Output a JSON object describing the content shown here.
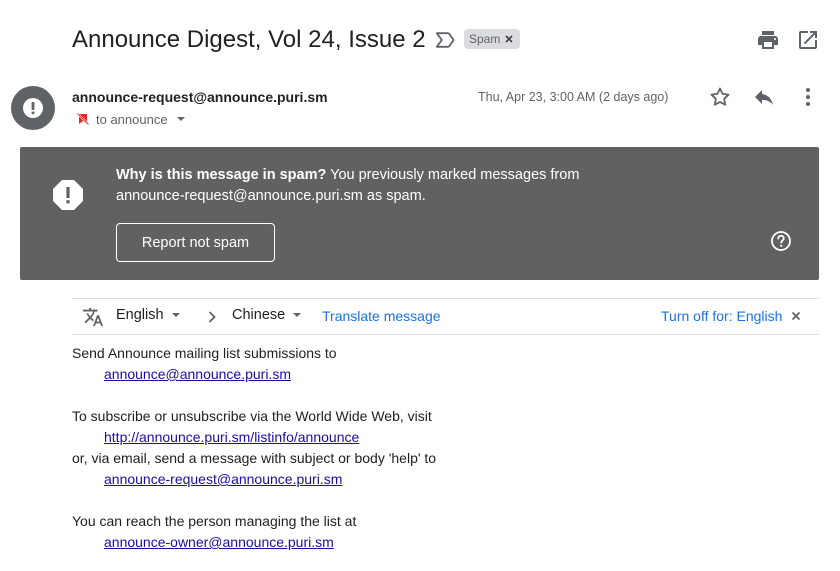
{
  "header": {
    "subject": "Announce Digest, Vol 24, Issue 2",
    "spam_label": "Spam",
    "icons": {
      "label": "label-outline-icon",
      "print": "print-icon",
      "popout": "open-in-new-window-icon"
    }
  },
  "message": {
    "sender_email": "announce-request@announce.puri.sm",
    "to_text": "to announce",
    "date": "Thu, Apr 23, 3:00 AM (2 days ago)",
    "icons": {
      "avatar": "exclamation-icon",
      "star": "star-icon",
      "reply": "reply-icon",
      "more": "more-vert-icon"
    }
  },
  "spam_banner": {
    "title": "Why is this message in spam?",
    "text": "You previously marked messages from announce-request@announce.puri.sm as spam.",
    "button": "Report not spam",
    "background": "#616161"
  },
  "translate": {
    "from_lang": "English",
    "to_lang": "Chinese",
    "translate_link": "Translate message",
    "turn_off": "Turn off for: English"
  },
  "body": {
    "line1": "Send Announce mailing list submissions to",
    "link1": "announce@announce.puri.sm",
    "line2": "To subscribe or unsubscribe via the World Wide Web, visit",
    "link2": "http://announce.puri.sm/listinfo/announce",
    "line3": "or, via email, send a message with subject or body 'help' to",
    "link3": "announce-request@announce.puri.sm",
    "line4": "You can reach the person managing the list at",
    "link4": "announce-owner@announce.puri.sm"
  },
  "colors": {
    "link": "#1a0dab",
    "accent": "#1a73e8",
    "banner": "#616161"
  }
}
